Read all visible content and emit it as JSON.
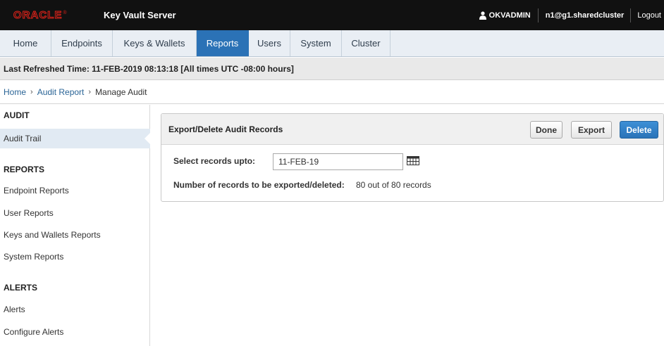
{
  "header": {
    "logo_text": "ORACLE",
    "logo_mark": "®",
    "product": "Key Vault Server",
    "user": "OKVADMIN",
    "cluster": "n1@g1.sharedcluster",
    "logout": "Logout",
    "user_icon": "person-icon"
  },
  "nav": {
    "tabs": [
      {
        "label": "Home"
      },
      {
        "label": "Endpoints"
      },
      {
        "label": "Keys & Wallets"
      },
      {
        "label": "Reports",
        "active": true
      },
      {
        "label": "Users"
      },
      {
        "label": "System"
      },
      {
        "label": "Cluster"
      }
    ],
    "active_color": "#2b72b6"
  },
  "refresh_bar": {
    "text": "Last Refreshed Time: 11-FEB-2019 08:13:18 [All times UTC -08:00 hours]"
  },
  "breadcrumb": {
    "items": [
      "Home",
      "Audit Report",
      "Manage Audit"
    ],
    "separator": "›"
  },
  "sidebar": {
    "sections": [
      {
        "heading": "AUDIT",
        "items": [
          "Audit Trail"
        ]
      },
      {
        "heading": "REPORTS",
        "items": [
          "Endpoint Reports",
          "User Reports",
          "Keys and Wallets Reports",
          "System Reports"
        ]
      },
      {
        "heading": "ALERTS",
        "items": [
          "Alerts",
          "Configure Alerts"
        ]
      }
    ],
    "active_item": "Audit Trail"
  },
  "panel": {
    "title": "Export/Delete Audit Records",
    "buttons": {
      "done": "Done",
      "export": "Export",
      "delete": "Delete"
    },
    "select_label": "Select records upto:",
    "date_value": "11-FEB-19",
    "calendar_icon": "calendar-icon",
    "count_label": "Number of records to be exported/deleted:",
    "count_value": "80 out of 80 records"
  }
}
